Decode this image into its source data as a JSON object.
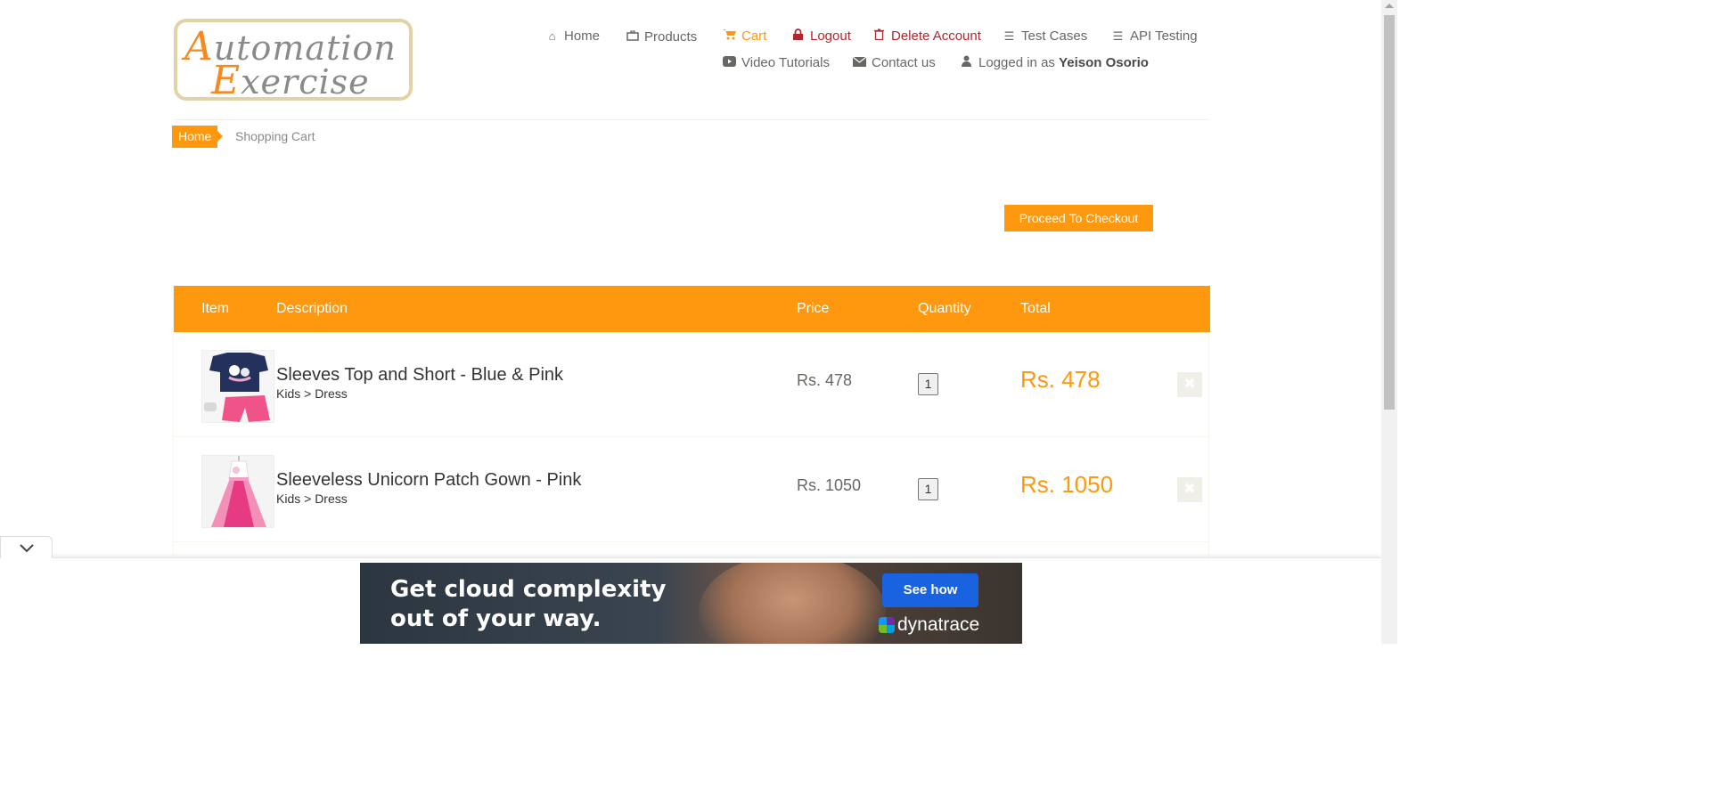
{
  "logo": {
    "line1_cap": "A",
    "line1_rest": "utomation",
    "line2_cap": "E",
    "line2_rest": "xercise"
  },
  "nav": {
    "home": "Home",
    "products": "Products",
    "cart": "Cart",
    "logout": "Logout",
    "delete_account": "Delete Account",
    "test_cases": "Test Cases",
    "api_testing": "API Testing",
    "video_tutorials": "Video Tutorials",
    "contact_us": "Contact us",
    "logged_in_prefix": "Logged in as",
    "logged_in_user": "Yeison Osorio"
  },
  "breadcrumb": {
    "home": "Home",
    "current": "Shopping Cart"
  },
  "checkout_button": "Proceed To Checkout",
  "table": {
    "headers": {
      "item": "Item",
      "description": "Description",
      "price": "Price",
      "quantity": "Quantity",
      "total": "Total"
    },
    "rows": [
      {
        "name": "Sleeves Top and Short - Blue & Pink",
        "category": "Kids > Dress",
        "price": "Rs. 478",
        "quantity": "1",
        "total": "Rs. 478",
        "image": "blue-top-pink-shorts"
      },
      {
        "name": "Sleeveless Unicorn Patch Gown - Pink",
        "category": "Kids > Dress",
        "price": "Rs. 1050",
        "quantity": "1",
        "total": "Rs. 1050",
        "image": "pink-gown"
      }
    ]
  },
  "ad": {
    "headline_line1": "Get cloud complexity",
    "headline_line2": "out of your way.",
    "cta": "See how",
    "brand": "dynatrace"
  },
  "colors": {
    "accent": "#fe980f",
    "logout_red": "#b0282f",
    "text": "#696763"
  }
}
